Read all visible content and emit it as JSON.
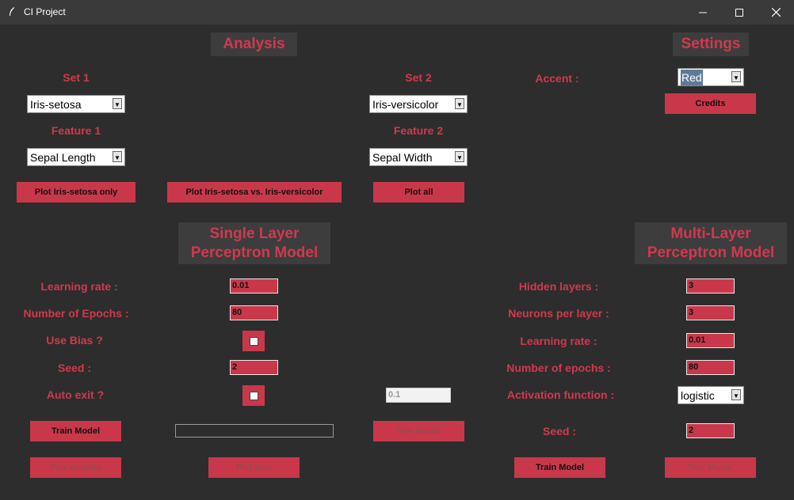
{
  "window": {
    "title": "CI Project"
  },
  "analysis": {
    "header": "Analysis",
    "set1_label": "Set 1",
    "set1_value": "Iris-setosa",
    "feature1_label": "Feature 1",
    "feature1_value": "Sepal Length",
    "set2_label": "Set 2",
    "set2_value": "Iris-versicolor",
    "feature2_label": "Feature 2",
    "feature2_value": "Sepal Width",
    "plot_single_label": "Plot Iris-setosa only",
    "plot_vs_label": "Plot Iris-setosa vs. Iris-versicolor",
    "plot_all_label": "Plot all"
  },
  "settings": {
    "header": "Settings",
    "accent_label": "Accent :",
    "accent_value": "Red",
    "credits_label": "Credits"
  },
  "slp": {
    "header_line1": "Single Layer",
    "header_line2": "Perceptron Model",
    "learning_rate_label": "Learning rate :",
    "learning_rate_value": "0.01",
    "epochs_label": "Number of Epochs :",
    "epochs_value": "80",
    "use_bias_label": "Use Bias ?",
    "use_bias_checked": false,
    "seed_label": "Seed :",
    "seed_value": "2",
    "auto_exit_label": "Auto exit ?",
    "auto_exit_checked": false,
    "auto_exit_threshold": "0.1",
    "train_label": "Train Model",
    "progress": 0,
    "test_label": "Test Model",
    "plot_weights_label": "Plot weights",
    "plot_bias_label": "Plot bias"
  },
  "mlp": {
    "header_line1": "Multi-Layer",
    "header_line2": "Perceptron Model",
    "hidden_layers_label": "Hidden layers :",
    "hidden_layers_value": "3",
    "neurons_label": "Neurons per layer :",
    "neurons_value": "3",
    "learning_rate_label": "Learning rate :",
    "learning_rate_value": "0.01",
    "epochs_label": "Number of epochs :",
    "epochs_value": "80",
    "activation_label": "Activation function :",
    "activation_value": "logistic",
    "seed_label": "Seed :",
    "seed_value": "2",
    "train_label": "Train Model",
    "test_label": "Test Model"
  },
  "colors": {
    "accent": "#c9384a",
    "background": "#2d2d2d",
    "header_bg": "#3d3d3d"
  }
}
